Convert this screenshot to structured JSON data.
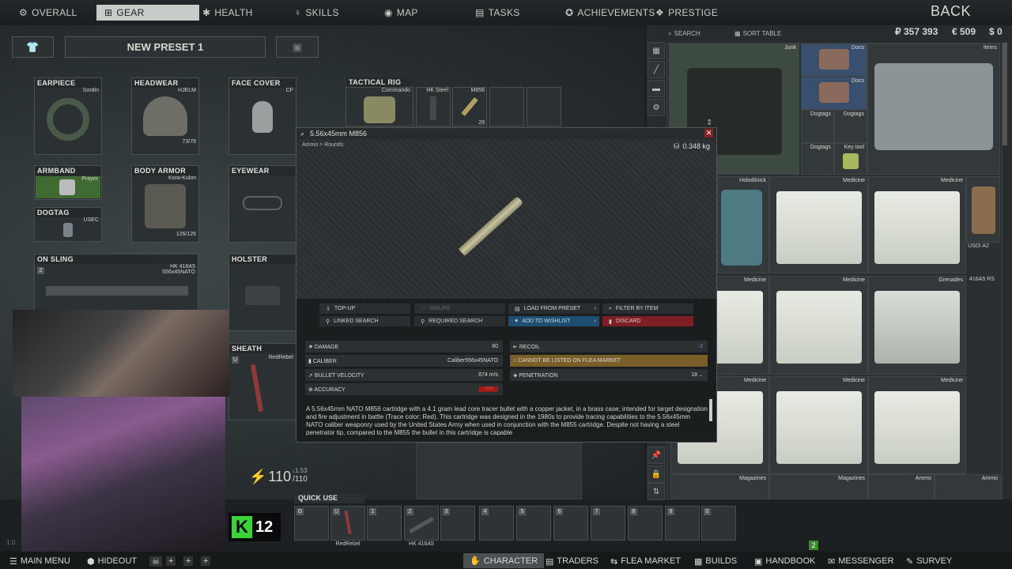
{
  "topnav": {
    "items": [
      {
        "icon": "gear-icon",
        "label": "OVERALL"
      },
      {
        "icon": "gear-icon",
        "label": "GEAR"
      },
      {
        "icon": "health-icon",
        "label": "HEALTH"
      },
      {
        "icon": "skills-icon",
        "label": "SKILLS"
      },
      {
        "icon": "map-icon",
        "label": "MAP"
      },
      {
        "icon": "tasks-icon",
        "label": "TASKS"
      },
      {
        "icon": "achievements-icon",
        "label": "ACHIEVEMENTS"
      },
      {
        "icon": "prestige-icon",
        "label": "PRESTIGE"
      }
    ],
    "back": "BACK"
  },
  "currency": {
    "roubles": "₽ 357 393",
    "euros": "€ 509",
    "dollars": "$ 0"
  },
  "preset": {
    "name": "NEW PRESET 1"
  },
  "slots": {
    "earpiece": {
      "label": "EARPIECE",
      "item": "Sordin"
    },
    "headwear": {
      "label": "HEADWEAR",
      "item": "HJELM",
      "durability": "73/78"
    },
    "face_cover": {
      "label": "FACE COVER",
      "item": "CF"
    },
    "tactical_rig": {
      "label": "TACTICAL RIG",
      "item": "Commando",
      "cell1": "HK Steel",
      "cell2": "M856",
      "cell2_count": "29"
    },
    "armband": {
      "label": "ARMBAND",
      "item": "Prayer"
    },
    "body_armor": {
      "label": "BODY ARMOR",
      "item": "Kora-Kulon",
      "durability": "126/126"
    },
    "eyewear": {
      "label": "EYEWEAR"
    },
    "dogtag": {
      "label": "DOGTAG",
      "item": "USEC"
    },
    "on_sling": {
      "label": "ON SLING",
      "item": "HK 416A5",
      "sub": "556x45NATO",
      "badge": "2"
    },
    "holster": {
      "label": "HOLSTER"
    },
    "sheath": {
      "label": "SHEATH",
      "item": "RedRebel",
      "badge": "U"
    }
  },
  "energy": {
    "value": "110",
    "max": "/110",
    "rate": "1.53"
  },
  "overlay_badge": "12",
  "quick_use": {
    "label": "QUICK USE",
    "slots": [
      {
        "key": "G",
        "name": ""
      },
      {
        "key": "U",
        "name": "RedRebel"
      },
      {
        "key": "1",
        "name": ""
      },
      {
        "key": "2",
        "name": "HK 416A5"
      },
      {
        "key": "3",
        "name": ""
      },
      {
        "key": "4",
        "name": ""
      },
      {
        "key": "5",
        "name": ""
      },
      {
        "key": "6",
        "name": ""
      },
      {
        "key": "7",
        "name": ""
      },
      {
        "key": "8",
        "name": ""
      },
      {
        "key": "9",
        "name": ""
      },
      {
        "key": "0",
        "name": ""
      }
    ]
  },
  "stash": {
    "search": "SEARCH",
    "sort": "SORT TABLE",
    "labels": {
      "junk": "Junk",
      "docs1": "Docs",
      "docs2": "Docs",
      "items": "Items",
      "dogtags1": "Dogtags",
      "dogtags2": "Dogtags",
      "dogtags3": "Dogtags",
      "keytool": "Key tool",
      "holodilnick": "Holodilnick",
      "medicine1": "Medicine",
      "medicine2": "Medicine",
      "medicine3": "Medicine",
      "medicine4": "Medicine",
      "medicine5": "Medicine",
      "medicine6": "Medicine",
      "medicine7": "Medicine",
      "grenades": "Grenades",
      "magazines1": "Magazines",
      "magazines2": "Magazines",
      "ammo1": "Ammo",
      "ammo2": "Ammo",
      "usdi": "USDI A2",
      "hk416": "416A5 RS"
    }
  },
  "modal": {
    "title": "5.56x45mm M856",
    "breadcrumb": "Ammo > Rounds",
    "weight": "0.348 kg",
    "actions": {
      "topup": "TOP-UP",
      "insure": "INSURE",
      "load_preset": "LOAD FROM PRESET",
      "filter": "FILTER BY ITEM",
      "linked": "LINKED SEARCH",
      "required": "REQUIRED SEARCH",
      "wishlist": "ADD TO WISHLIST",
      "discard": "DISCARD"
    },
    "stats": {
      "damage": {
        "label": "DAMAGE",
        "value": "60"
      },
      "caliber": {
        "label": "CALIBER",
        "value": "Caliber556x45NATO"
      },
      "velocity": {
        "label": "BULLET VELOCITY",
        "value": "874 m/s"
      },
      "accuracy": {
        "label": "ACCURACY",
        "value": "-5%"
      },
      "recoil": {
        "label": "RECOIL",
        "value": "-2"
      },
      "flea": {
        "label": "CANNOT BE LISTED ON FLEA MARKET"
      },
      "penetration": {
        "label": "PENETRATION",
        "value": "18"
      }
    },
    "description": "A 5.56x45mm NATO M856 cartridge with a 4.1 gram lead core tracer bullet with a copper jacket, in a brass case; intended for target designation and fire adjustment in battle (Trace color: Red). This cartridge was designed in the 1980s to provide tracing capabilities to the 5.56x45mm NATO caliber weaponry used by the United States Army when used in conjunction with the M855 cartridge. Despite not having a steel penetrator tip, compared to the M855 the bullet in this cartridge is capable"
  },
  "bottomnav": {
    "main_menu": "MAIN MENU",
    "hideout": "HIDEOUT",
    "character": "CHARACTER",
    "traders": "TRADERS",
    "flea": "FLEA MARKET",
    "builds": "BUILDS",
    "handbook": "HANDBOOK",
    "messenger": "MESSENGER",
    "messenger_badge": "2",
    "survey": "SURVEY",
    "version": "1.0."
  },
  "colors": {
    "accent_active": "#c8ccc9",
    "flea_bar": "#7a5e2a",
    "discard": "#7e1f25",
    "wishlist": "#25608a",
    "overlay_green": "#3ad33a"
  }
}
